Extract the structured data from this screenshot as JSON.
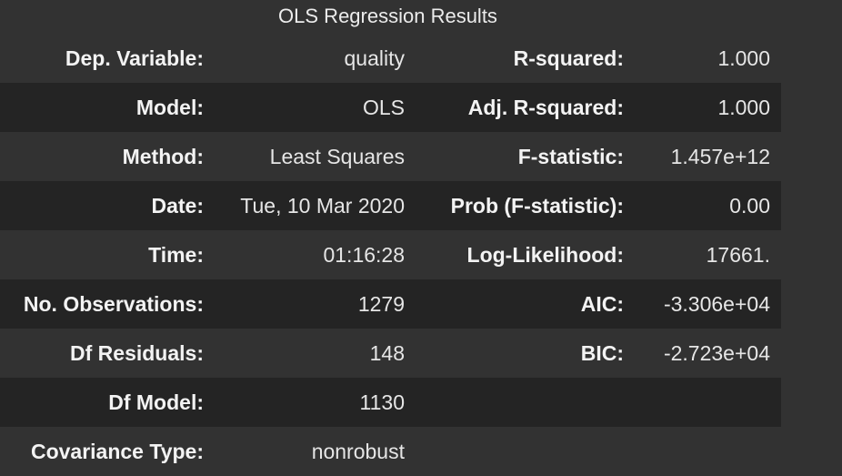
{
  "title": "OLS Regression Results",
  "rows": [
    {
      "label1": "Dep. Variable:",
      "value1": "quality",
      "label2": "R-squared:",
      "value2": "1.000"
    },
    {
      "label1": "Model:",
      "value1": "OLS",
      "label2": "Adj. R-squared:",
      "value2": "1.000"
    },
    {
      "label1": "Method:",
      "value1": "Least Squares",
      "label2": "F-statistic:",
      "value2": "1.457e+12"
    },
    {
      "label1": "Date:",
      "value1": "Tue, 10 Mar 2020",
      "label2": "Prob (F-statistic):",
      "value2": "0.00"
    },
    {
      "label1": "Time:",
      "value1": "01:16:28",
      "label2": "Log-Likelihood:",
      "value2": "17661."
    },
    {
      "label1": "No. Observations:",
      "value1": "1279",
      "label2": "AIC:",
      "value2": "-3.306e+04"
    },
    {
      "label1": "Df Residuals:",
      "value1": "148",
      "label2": "BIC:",
      "value2": "-2.723e+04"
    },
    {
      "label1": "Df Model:",
      "value1": "1130",
      "label2": "",
      "value2": ""
    },
    {
      "label1": "Covariance Type:",
      "value1": "nonrobust",
      "label2": "",
      "value2": ""
    }
  ]
}
